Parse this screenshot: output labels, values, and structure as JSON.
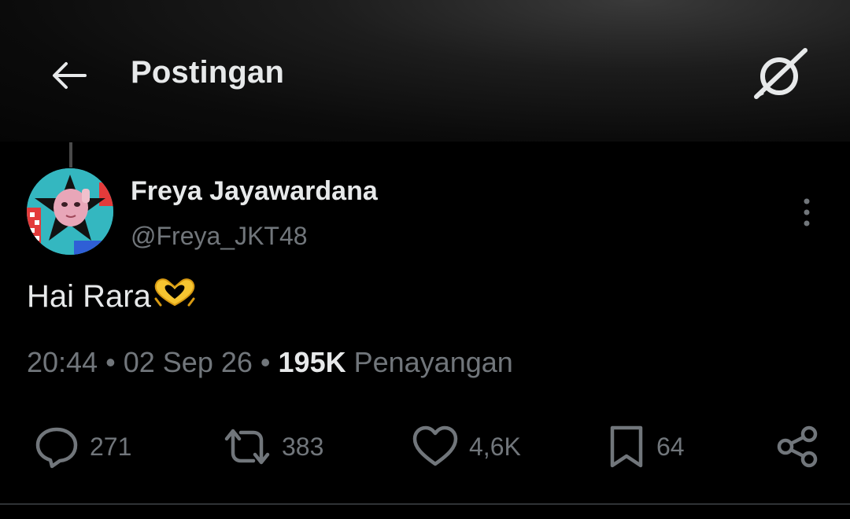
{
  "header": {
    "title": "Postingan",
    "back_icon": "arrow-left-icon",
    "grok_icon": "grok-icon"
  },
  "post": {
    "author": {
      "display_name": "Freya Jayawardana",
      "handle": "@Freya_JKT48"
    },
    "text": "Hai Rara",
    "emoji": "heart-hands-emoji",
    "meta": {
      "time": "20:44",
      "separator": "•",
      "date": "02 Sep 26",
      "views_count": "195K",
      "views_label": "Penayangan"
    },
    "actions": {
      "replies": "271",
      "reposts": "383",
      "likes": "4,6K",
      "bookmarks": "64"
    }
  },
  "colors": {
    "background": "#000000",
    "text_primary": "#e7e9ea",
    "text_secondary": "#71767b",
    "divider": "#2f3336"
  }
}
